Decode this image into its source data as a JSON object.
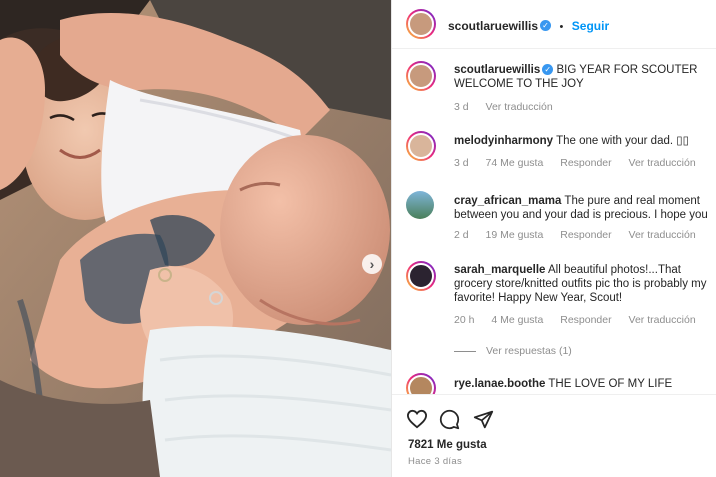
{
  "post": {
    "author": "scoutlaruewillis",
    "follow_label": "Seguir",
    "dot": "•",
    "caption_user": "scoutlaruewillis",
    "caption_text": "BIG YEAR FOR SCOUTER WELCOME TO THE JOY",
    "caption_time": "3 d",
    "caption_translate": "Ver traducción",
    "verified_mark": "✓",
    "next_icon": "chevron-right-icon",
    "next_glyph": "›"
  },
  "comments": [
    {
      "user": "melodyinharmony",
      "text": "The one with your dad. ▯▯",
      "time": "3 d",
      "likes": "74 Me gusta",
      "reply": "Responder",
      "translate": "Ver traducción"
    },
    {
      "user": "cray_african_mama",
      "text": "The pure and real moment between you and your dad is precious. I hope you have many more",
      "time": "2 d",
      "likes": "19 Me gusta",
      "reply": "Responder",
      "translate": "Ver traducción"
    },
    {
      "user": "sarah_marquelle",
      "text": "All beautiful photos!...That grocery store/knitted outfits pic tho is probably my favorite! Happy New Year, Scout!",
      "time": "20 h",
      "likes": "4 Me gusta",
      "reply": "Responder",
      "translate": "Ver traducción",
      "view_replies": "Ver respuestas (1)"
    },
    {
      "user": "rye.lanae.boothe",
      "text": "THE LOVE OF MY LIFE"
    }
  ],
  "footer": {
    "likes": "7821 Me gusta",
    "ago": "Hace 3 días"
  },
  "colors": {
    "link": "#0095f6",
    "muted": "#8e8e8e",
    "verified": "#3897f0"
  }
}
